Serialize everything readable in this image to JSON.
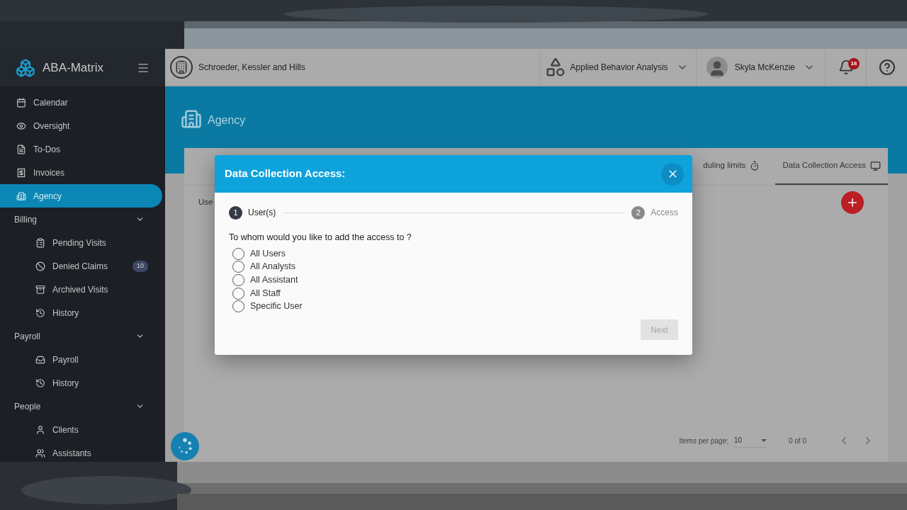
{
  "sidebar": {
    "brand": "ABA-Matrix",
    "items": [
      {
        "kind": "link",
        "label": "Calendar",
        "selected": false
      },
      {
        "kind": "link",
        "label": "Oversight",
        "selected": false
      },
      {
        "kind": "link",
        "label": "To-Dos",
        "selected": false
      },
      {
        "kind": "link",
        "label": "Invoices",
        "selected": false
      },
      {
        "kind": "link",
        "label": "Agency",
        "selected": true
      },
      {
        "kind": "section",
        "label": "Billing",
        "expanded": true,
        "children": [
          {
            "label": "Pending Visits",
            "selected": false
          },
          {
            "label": "Denied Claims",
            "selected": false,
            "badge": "10"
          },
          {
            "label": "Archived Visits",
            "selected": false
          },
          {
            "label": "History",
            "selected": false
          }
        ]
      },
      {
        "kind": "section",
        "label": "Payroll",
        "expanded": true,
        "children": [
          {
            "label": "Payroll",
            "selected": false
          },
          {
            "label": "History",
            "selected": false
          }
        ]
      },
      {
        "kind": "section",
        "label": "People",
        "expanded": true,
        "children": [
          {
            "label": "Clients",
            "selected": false
          },
          {
            "label": "Assistants",
            "selected": false
          }
        ]
      }
    ]
  },
  "header": {
    "organization": "Schroeder, Kessler and Hills",
    "program": "Applied Behavior Analysis",
    "user": "Skyla McKenzie",
    "notifications": "16"
  },
  "page": {
    "title": "Agency",
    "tabs": [
      {
        "label": "duling limits",
        "selected": false
      },
      {
        "label": "Data Collection Access",
        "selected": true
      }
    ],
    "column_1": "Use",
    "pagination": {
      "items_per_page_label": "Items per page:",
      "items_per_page": "10",
      "range": "0 of 0"
    }
  },
  "dialog": {
    "title": "Data Collection Access:",
    "steps": [
      {
        "number": "1",
        "label": "User(s)",
        "active": true
      },
      {
        "number": "2",
        "label": "Access",
        "active": false
      }
    ],
    "question": "To whom would you like to add the access to ?",
    "options": [
      {
        "label": "All Users",
        "selected": false
      },
      {
        "label": "All Analysts",
        "selected": false
      },
      {
        "label": "All Assistant",
        "selected": false
      },
      {
        "label": "All Staff",
        "selected": false
      },
      {
        "label": "Specific User",
        "selected": false
      }
    ],
    "next_button": {
      "label": "Next",
      "disabled": true
    }
  }
}
